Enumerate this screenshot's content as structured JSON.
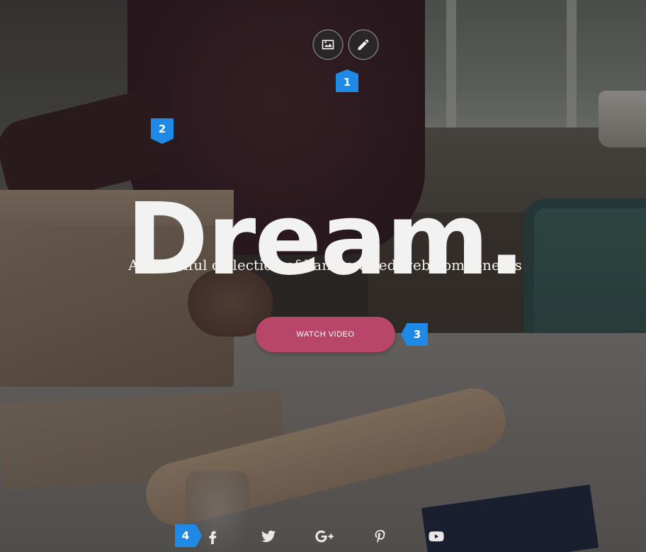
{
  "toolbar": {
    "buttons": [
      {
        "id": "image",
        "icon": "image-icon"
      },
      {
        "id": "edit",
        "icon": "pencil-icon"
      }
    ]
  },
  "markers": [
    "1",
    "2",
    "3",
    "4"
  ],
  "hero": {
    "headline": "Dream.",
    "subtitle": "A beautiful collection of hand-crafted web components",
    "cta_label": "WATCH VIDEO",
    "cta_color": "#b8456a"
  },
  "social": [
    {
      "network": "facebook",
      "icon": "facebook-icon"
    },
    {
      "network": "twitter",
      "icon": "twitter-icon"
    },
    {
      "network": "google-plus",
      "icon": "google-plus-icon"
    },
    {
      "network": "pinterest",
      "icon": "pinterest-icon"
    },
    {
      "network": "youtube",
      "icon": "youtube-icon"
    }
  ],
  "colors": {
    "marker": "#1e8ae6",
    "headline": "#f2f2f2"
  }
}
